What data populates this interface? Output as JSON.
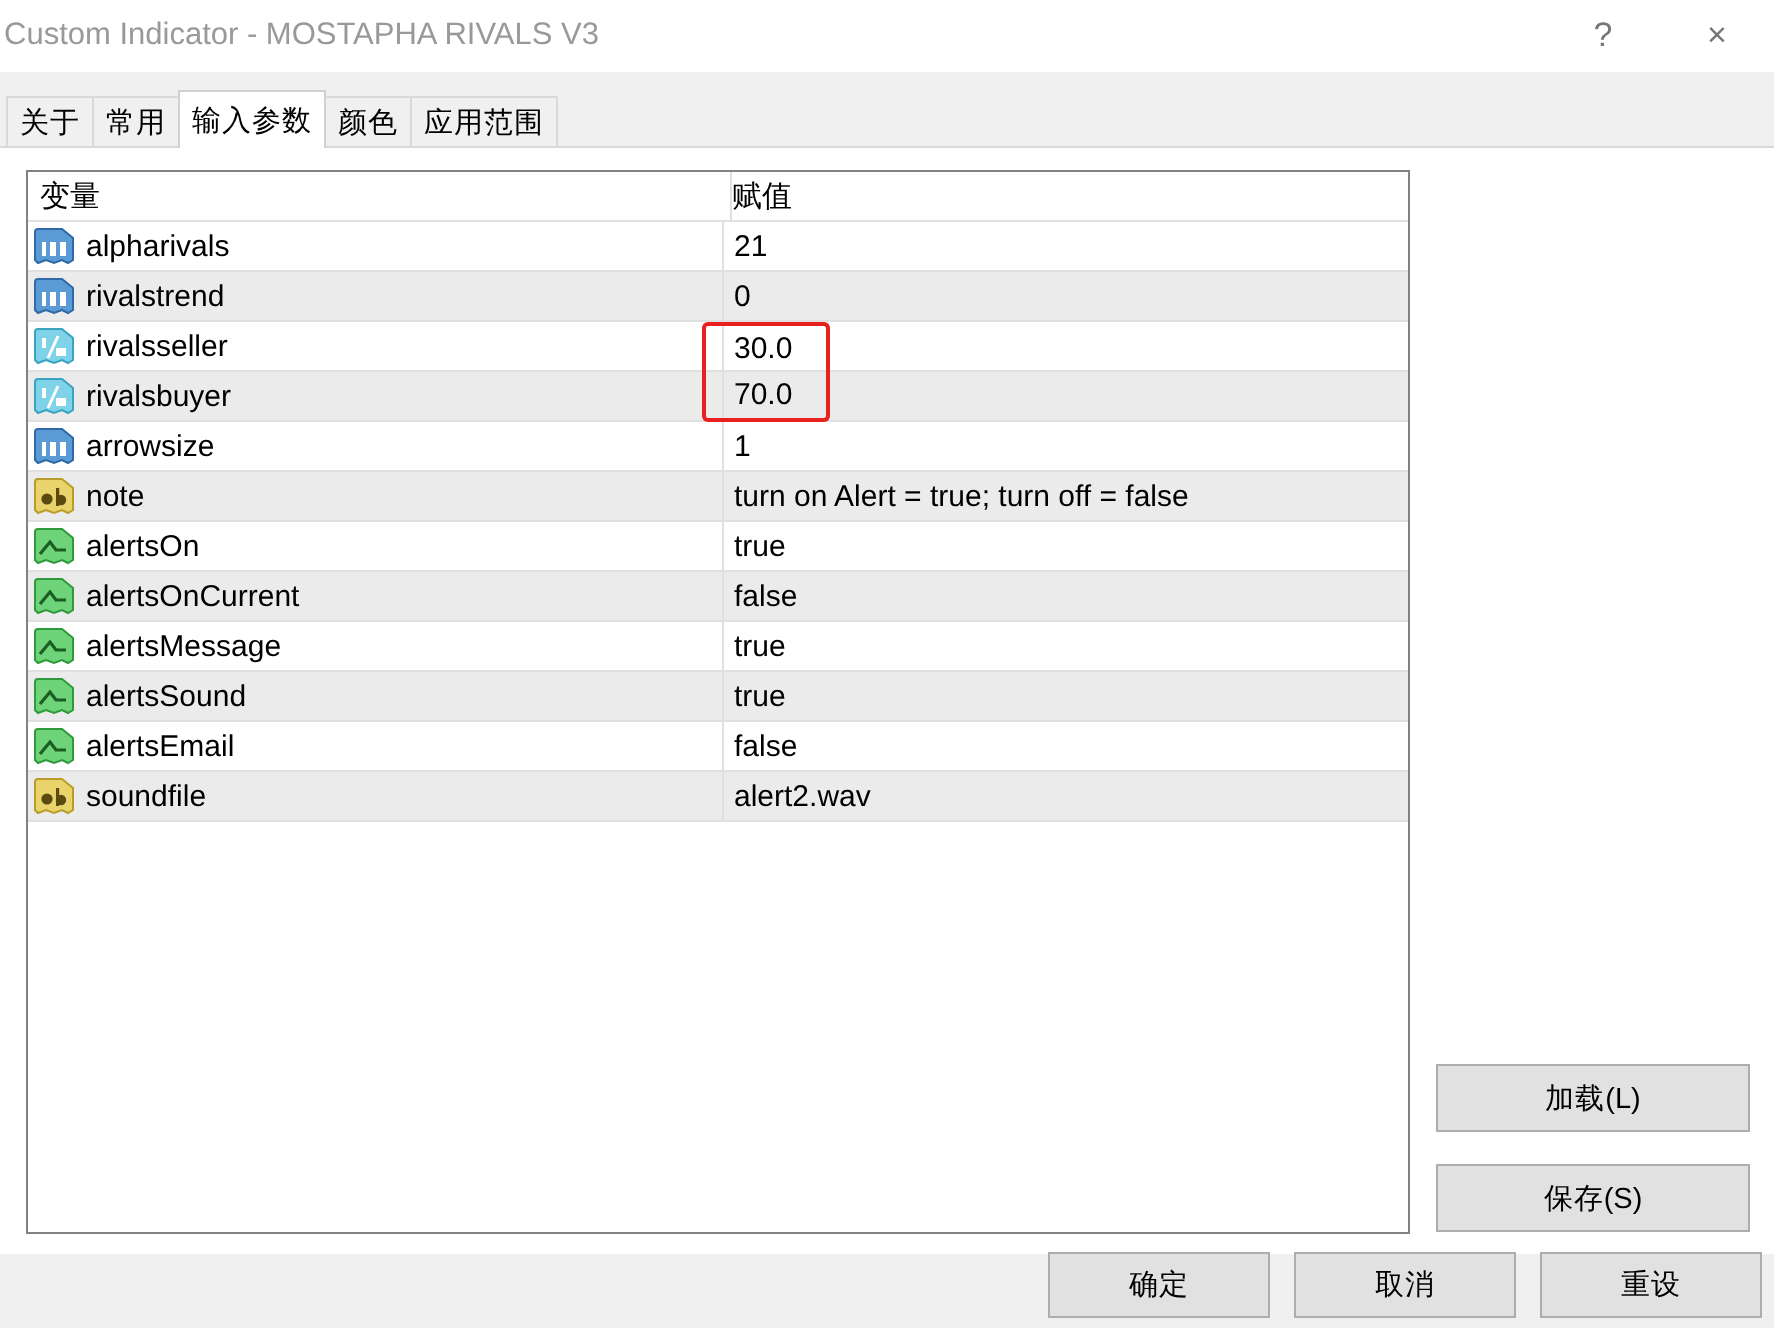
{
  "window": {
    "title": "Custom Indicator - MOSTAPHA RIVALS V3",
    "help": "?",
    "close": "×"
  },
  "tabs": [
    {
      "label": "关于",
      "selected": false
    },
    {
      "label": "常用",
      "selected": false
    },
    {
      "label": "输入参数",
      "selected": true
    },
    {
      "label": "颜色",
      "selected": false
    },
    {
      "label": "应用范围",
      "selected": false
    }
  ],
  "table": {
    "columns": [
      "变量",
      "赋值"
    ],
    "rows": [
      {
        "kind": "int",
        "name": "alpharivals",
        "value": "21",
        "highlighted": false
      },
      {
        "kind": "int",
        "name": "rivalstrend",
        "value": "0",
        "highlighted": false
      },
      {
        "kind": "double",
        "name": "rivalsseller",
        "value": "30.0",
        "highlighted": true
      },
      {
        "kind": "double",
        "name": "rivalsbuyer",
        "value": "70.0",
        "highlighted": true
      },
      {
        "kind": "int",
        "name": "arrowsize",
        "value": "1",
        "highlighted": false
      },
      {
        "kind": "string",
        "name": "note",
        "value": "turn on Alert = true; turn off = false",
        "highlighted": false
      },
      {
        "kind": "bool",
        "name": "alertsOn",
        "value": "true",
        "highlighted": false
      },
      {
        "kind": "bool",
        "name": "alertsOnCurrent",
        "value": "false",
        "highlighted": false
      },
      {
        "kind": "bool",
        "name": "alertsMessage",
        "value": "true",
        "highlighted": false
      },
      {
        "kind": "bool",
        "name": "alertsSound",
        "value": "true",
        "highlighted": false
      },
      {
        "kind": "bool",
        "name": "alertsEmail",
        "value": "false",
        "highlighted": false
      },
      {
        "kind": "string",
        "name": "soundfile",
        "value": "alert2.wav",
        "highlighted": false
      }
    ]
  },
  "side_buttons": [
    "加载(L)",
    "保存(S)"
  ],
  "buttons": [
    "确定",
    "取消",
    "重设"
  ]
}
